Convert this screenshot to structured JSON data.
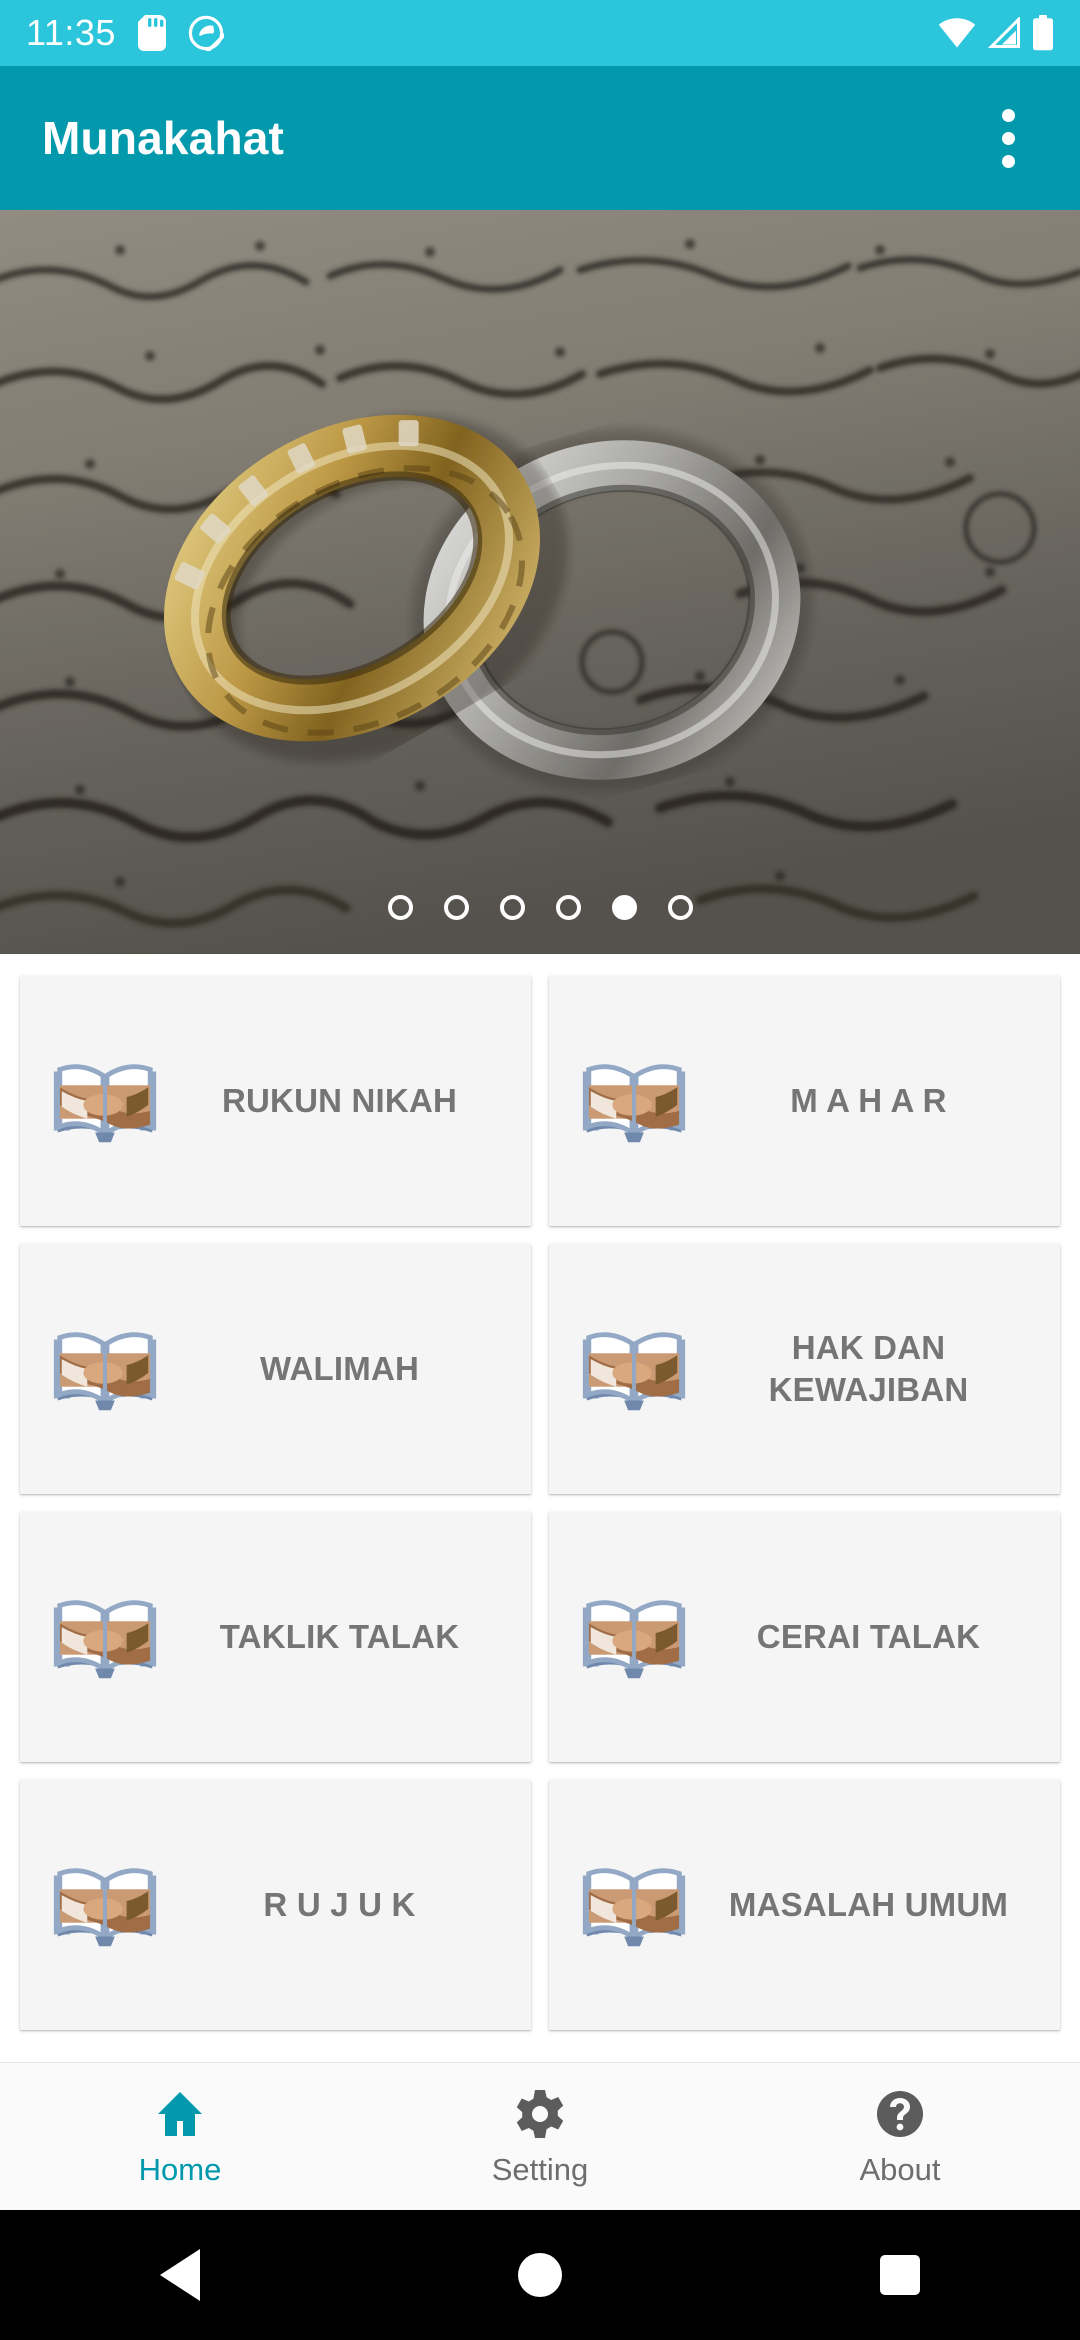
{
  "status_bar": {
    "time": "11:35",
    "background": "#2CC6DC",
    "icons": [
      "sd-card-icon",
      "do-not-disturb-icon",
      "wifi-icon",
      "cellular-signal-icon",
      "battery-icon"
    ]
  },
  "app_bar": {
    "title": "Munakahat",
    "background": "#0399AC",
    "overflow_menu": "overflow-menu-icon"
  },
  "banner": {
    "description": "Two wedding rings resting on an open Quran page",
    "dot_count": 6,
    "active_dot_index": 4
  },
  "grid": {
    "rows": [
      [
        {
          "label": "RUKUN NIKAH",
          "icon": "book-handshake-icon",
          "spaced": false
        },
        {
          "label": "M A H A R",
          "icon": "book-handshake-icon",
          "spaced": false
        }
      ],
      [
        {
          "label": "WALIMAH",
          "icon": "book-handshake-icon",
          "spaced": false
        },
        {
          "label": "HAK DAN KEWAJIBAN",
          "icon": "book-handshake-icon",
          "spaced": false
        }
      ],
      [
        {
          "label": "TAKLIK TALAK",
          "icon": "book-handshake-icon",
          "spaced": false
        },
        {
          "label": "CERAI TALAK",
          "icon": "book-handshake-icon",
          "spaced": false
        }
      ],
      [
        {
          "label": "R U J U K",
          "icon": "book-handshake-icon",
          "spaced": false
        },
        {
          "label": "MASALAH UMUM",
          "icon": "book-handshake-icon",
          "spaced": false
        }
      ]
    ]
  },
  "bottom_nav": {
    "active_color": "#0399AC",
    "inactive_color": "#6E6E6E",
    "items": [
      {
        "label": "Home",
        "icon": "home-icon",
        "active": true
      },
      {
        "label": "Setting",
        "icon": "gear-icon",
        "active": false
      },
      {
        "label": "About",
        "icon": "question-circle-icon",
        "active": false
      }
    ]
  },
  "android_nav": {
    "buttons": [
      "back-button",
      "home-button",
      "recents-button"
    ]
  }
}
